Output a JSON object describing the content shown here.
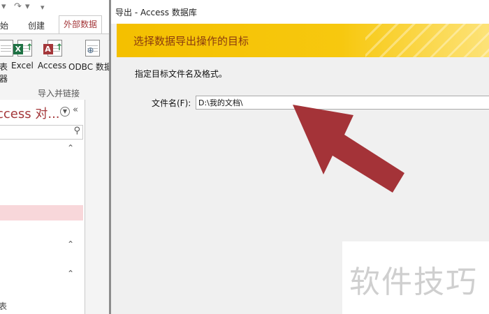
{
  "access": {
    "tabs": [
      "始",
      "创建",
      "外部数据"
    ],
    "ribbon": {
      "buttons": [
        {
          "label": "表",
          "label2": "器",
          "letter": ""
        },
        {
          "label": "Excel",
          "letter": "X"
        },
        {
          "label": "Access",
          "letter": "A"
        },
        {
          "label": "ODBC 数据",
          "letter": ""
        }
      ],
      "group_label": "导入并链接"
    },
    "nav": {
      "title": "ccess 对...",
      "bottom_label": "表"
    }
  },
  "dialog": {
    "title": "导出 - Access 数据库",
    "heading": "选择数据导出操作的目标",
    "instruction": "指定目标文件名及格式。",
    "filename_label": "文件名(F):",
    "filename_value": "D:\\我的文档\\"
  },
  "watermark": "软件技巧",
  "colors": {
    "accent": "#a4373a",
    "banner": "#f7c40a",
    "arrow": "#a43338",
    "nav_selected": "#f8d7da"
  }
}
